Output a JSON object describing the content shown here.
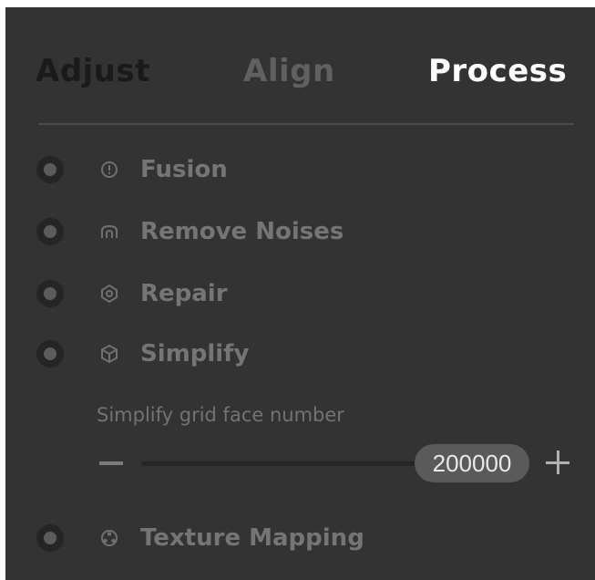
{
  "tabs": {
    "adjust": "Adjust",
    "align": "Align",
    "process": "Process",
    "active": "Process"
  },
  "items": [
    {
      "label": "Fusion",
      "icon": "fusion-icon",
      "selected": false
    },
    {
      "label": "Remove Noises",
      "icon": "remove-noises-icon",
      "selected": false
    },
    {
      "label": "Repair",
      "icon": "repair-icon",
      "selected": false
    },
    {
      "label": "Simplify",
      "icon": "simplify-icon",
      "selected": false
    },
    {
      "label": "Texture Mapping",
      "icon": "texture-mapping-icon",
      "selected": false
    }
  ],
  "simplify": {
    "label": "Simplify grid face number",
    "value": "200000"
  },
  "colors": {
    "panel_bg": "#333333",
    "active_tab": "#ffffff",
    "inactive_tab": "#606060",
    "item_text": "#757575"
  }
}
